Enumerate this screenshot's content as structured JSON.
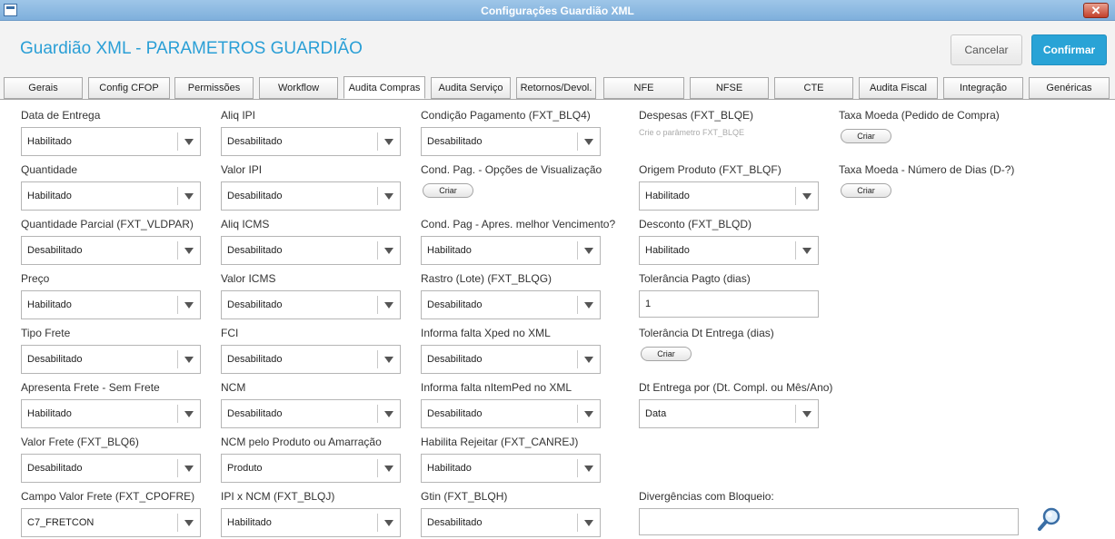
{
  "window": {
    "title": "Configurações Guardião XML"
  },
  "header": {
    "heading": "Guardião XML - PARAMETROS GUARDIÃO",
    "cancel_label": "Cancelar",
    "confirm_label": "Confirmar"
  },
  "tabs": [
    "Gerais",
    "Config CFOP",
    "Permissões",
    "Workflow",
    "Audita Compras",
    "Audita Serviço",
    "Retornos/Devol.",
    "NFE",
    "NFSE",
    "CTE",
    "Audita Fiscal",
    "Integração",
    "Genéricas"
  ],
  "active_tab": "Audita Compras",
  "colors": {
    "accent": "#2a9fd6",
    "confirm_bg": "#29a3d6",
    "titlebar": "#8fbbe2"
  },
  "columns": [
    [
      {
        "label": "Data de Entrega",
        "type": "select",
        "value": "Habilitado"
      },
      {
        "label": "Quantidade",
        "type": "select",
        "value": "Habilitado"
      },
      {
        "label": "Quantidade Parcial (FXT_VLDPAR)",
        "type": "select",
        "value": "Desabilitado"
      },
      {
        "label": "Preço",
        "type": "select",
        "value": "Habilitado"
      },
      {
        "label": "Tipo Frete",
        "type": "select",
        "value": "Desabilitado"
      },
      {
        "label": "Apresenta Frete - Sem Frete",
        "type": "select",
        "value": "Habilitado"
      },
      {
        "label": "Valor Frete (FXT_BLQ6)",
        "type": "select",
        "value": "Desabilitado"
      },
      {
        "label": "Campo Valor Frete (FXT_CPOFRE)",
        "type": "select",
        "value": "C7_FRETCON"
      }
    ],
    [
      {
        "label": "Aliq IPI",
        "type": "select",
        "value": "Desabilitado"
      },
      {
        "label": "Valor IPI",
        "type": "select",
        "value": "Desabilitado"
      },
      {
        "label": "Aliq ICMS",
        "type": "select",
        "value": "Desabilitado"
      },
      {
        "label": "Valor ICMS",
        "type": "select",
        "value": "Desabilitado"
      },
      {
        "label": "FCI",
        "type": "select",
        "value": "Desabilitado"
      },
      {
        "label": "NCM",
        "type": "select",
        "value": "Desabilitado"
      },
      {
        "label": "NCM pelo Produto ou Amarração",
        "type": "select",
        "value": "Produto"
      },
      {
        "label": "IPI x NCM (FXT_BLQJ)",
        "type": "select",
        "value": "Habilitado"
      }
    ],
    [
      {
        "label": "Condição Pagamento (FXT_BLQ4)",
        "type": "select",
        "value": "Desabilitado"
      },
      {
        "label": "Cond. Pag. - Opções de Visualização",
        "type": "button",
        "value": "Criar"
      },
      {
        "label": "Cond. Pag - Apres. melhor Vencimento?",
        "type": "select",
        "value": "Habilitado"
      },
      {
        "label": "Rastro (Lote) (FXT_BLQG)",
        "type": "select",
        "value": "Desabilitado"
      },
      {
        "label": "Informa falta Xped no XML",
        "type": "select",
        "value": "Desabilitado"
      },
      {
        "label": "Informa falta nItemPed no XML",
        "type": "select",
        "value": "Desabilitado"
      },
      {
        "label": "Habilita Rejeitar (FXT_CANREJ)",
        "type": "select",
        "value": "Habilitado"
      },
      {
        "label": "Gtin (FXT_BLQH)",
        "type": "select",
        "value": "Desabilitado"
      }
    ],
    [
      {
        "label": "Despesas (FXT_BLQE)",
        "type": "hint",
        "value": "Crie o parâmetro FXT_BLQE"
      },
      {
        "label": "Origem Produto (FXT_BLQF)",
        "type": "select",
        "value": "Habilitado"
      },
      {
        "label": "Desconto (FXT_BLQD)",
        "type": "select",
        "value": "Habilitado"
      },
      {
        "label": "Tolerância Pagto (dias)",
        "type": "input",
        "value": "1"
      },
      {
        "label": "Tolerância Dt Entrega (dias)",
        "type": "button",
        "value": "Criar"
      },
      {
        "label": "Dt Entrega por (Dt. Compl. ou Mês/Ano)",
        "type": "select",
        "value": "Data"
      },
      null,
      {
        "label": "Divergências com Bloqueio:",
        "type": "wide-input",
        "value": ""
      }
    ],
    [
      {
        "label": "Taxa Moeda (Pedido de Compra)",
        "type": "button",
        "value": "Criar"
      },
      {
        "label": "Taxa Moeda - Número de Dias (D-?)",
        "type": "button",
        "value": "Criar"
      }
    ]
  ]
}
